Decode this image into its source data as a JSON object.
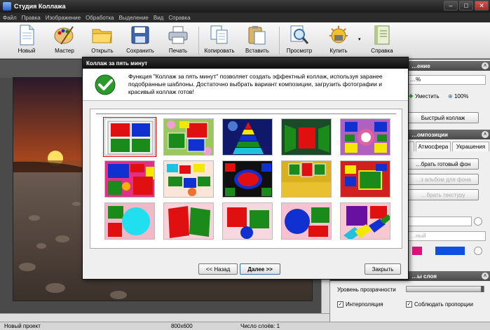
{
  "window": {
    "title": "Студия Коллажа"
  },
  "menu": [
    "Файл",
    "Правка",
    "Изображение",
    "Обработка",
    "Выделение",
    "Вид",
    "Справка"
  ],
  "toolbar": {
    "new": "Новый",
    "wizard": "Мастер",
    "open": "Открыть",
    "save": "Сохранить",
    "print": "Печать",
    "copy": "Копировать",
    "paste": "Вставить",
    "preview": "Просмотр",
    "buy": "Купить",
    "help": "Справка"
  },
  "right_panel": {
    "section1_title": "…ение",
    "zoom_value": "…%",
    "fit_label": "Уместить",
    "zoom100_label": "100%",
    "quick_collage": "Быстрый коллаж",
    "section2_title": "…омпозиции",
    "tab_atmosphere": "Атмосфера",
    "tab_decorations": "Украшения",
    "btn_ready_bg": "…брать готовый фон",
    "btn_album_bg": "…з альбом для фона",
    "btn_texture": "…брать текстуру",
    "combo_text": "…ный",
    "section3_title": "…ы слоя",
    "opacity_label": "Уровень прозрачности",
    "interpolation_label": "Интерполяция",
    "keep_proportions_label": "Соблюдать пропорции"
  },
  "dialog": {
    "title": "Коллаж за пять минут",
    "description": "Функция \"Коллаж за пять минут\" позволяет создать эффектный коллаж, используя заранее подобранные шаблоны. Достаточно выбрать вариант композиции, загрузить фотографии и красивый коллаж готов!",
    "back": "<< Назад",
    "next": "Далее >>",
    "close": "Закрыть"
  },
  "status": {
    "project": "Новый проект",
    "size": "800x600",
    "layers": "Число слоёв: 1"
  },
  "colors": {
    "titlebar": "#1a1a1a",
    "accent_red": "#e01010",
    "accent_green": "#1a8a1a",
    "accent_blue": "#1030d0",
    "accent_yellow": "#f5e800"
  }
}
